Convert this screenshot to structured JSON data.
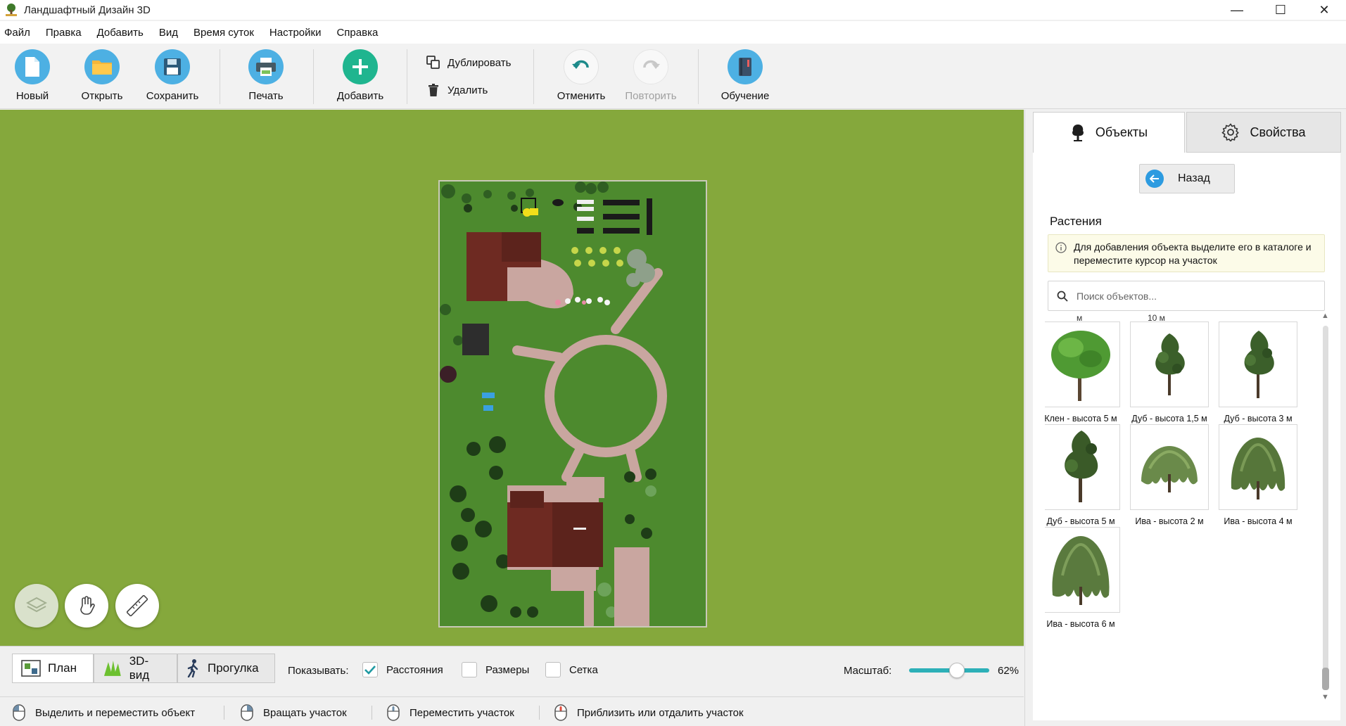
{
  "window": {
    "title": "Ландшафтный Дизайн 3D",
    "controls": {
      "minimize": "—",
      "maximize": "☐",
      "close": "✕"
    }
  },
  "menu": [
    "Файл",
    "Правка",
    "Добавить",
    "Вид",
    "Время суток",
    "Настройки",
    "Справка"
  ],
  "toolbar": {
    "new": "Новый",
    "open": "Открыть",
    "save": "Сохранить",
    "print": "Печать",
    "add": "Добавить",
    "duplicate": "Дублировать",
    "delete": "Удалить",
    "undo": "Отменить",
    "redo": "Повторить",
    "tutorial": "Обучение"
  },
  "viewbar": {
    "tabs": {
      "plan": "План",
      "view3d": "3D-вид",
      "walk": "Прогулка"
    },
    "active_tab": "План",
    "show_label": "Показывать:",
    "distances": {
      "label": "Расстояния",
      "checked": true
    },
    "sizes": {
      "label": "Размеры",
      "checked": false
    },
    "grid": {
      "label": "Сетка",
      "checked": false
    },
    "scale_label": "Масштаб:",
    "scale_value": "62%",
    "scale_fraction": 0.5
  },
  "statusbar": {
    "select_move": "Выделить и переместить объект",
    "rotate": "Вращать участок",
    "move": "Переместить участок",
    "zoom": "Приблизить или отдалить участок"
  },
  "panel": {
    "tabs": {
      "objects": "Объекты",
      "properties": "Свойства"
    },
    "active_tab": "Объекты",
    "back": "Назад",
    "category": "Растения",
    "info": "Для добавления объекта выделите его в каталоге и переместите курсор на участок",
    "search_placeholder": "Поиск объектов...",
    "cut_labels": [
      "м",
      "10 м"
    ],
    "items": [
      {
        "name": "Клен - высота 5 м",
        "kind": "maple"
      },
      {
        "name": "Дуб - высота 1,5 м",
        "kind": "oak"
      },
      {
        "name": "Дуб - высота 3 м",
        "kind": "oak"
      },
      {
        "name": "Дуб - высота 5 м",
        "kind": "oak"
      },
      {
        "name": "Ива - высота 2 м",
        "kind": "willow"
      },
      {
        "name": "Ива - высота 4 м",
        "kind": "willow"
      },
      {
        "name": "Ива - высота 6 м",
        "kind": "willow"
      }
    ]
  },
  "colors": {
    "accent": "#2db0b8",
    "lawn": "#85a83c",
    "plot": "#4d8a2e",
    "roof": "#6e2a22",
    "paving": "#c9a6a0"
  }
}
